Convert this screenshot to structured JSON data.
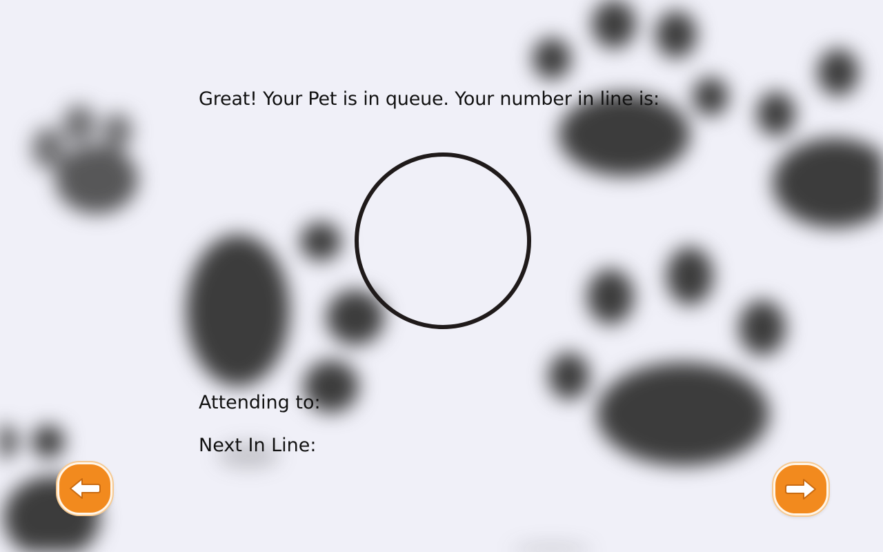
{
  "queue": {
    "message": "Great! Your Pet is in queue. Your number in line is:",
    "number": ""
  },
  "status": {
    "attending_label": "Attending to:",
    "attending_value": "",
    "next_label": "Next In Line:",
    "next_value": ""
  },
  "navigation": {
    "back_icon": "arrow-left-icon",
    "forward_icon": "arrow-right-icon"
  },
  "colors": {
    "background": "#f0f0f8",
    "accent": "#f28a1e",
    "paw": "#3c3c3c",
    "circle_border": "#1f1a1a"
  }
}
